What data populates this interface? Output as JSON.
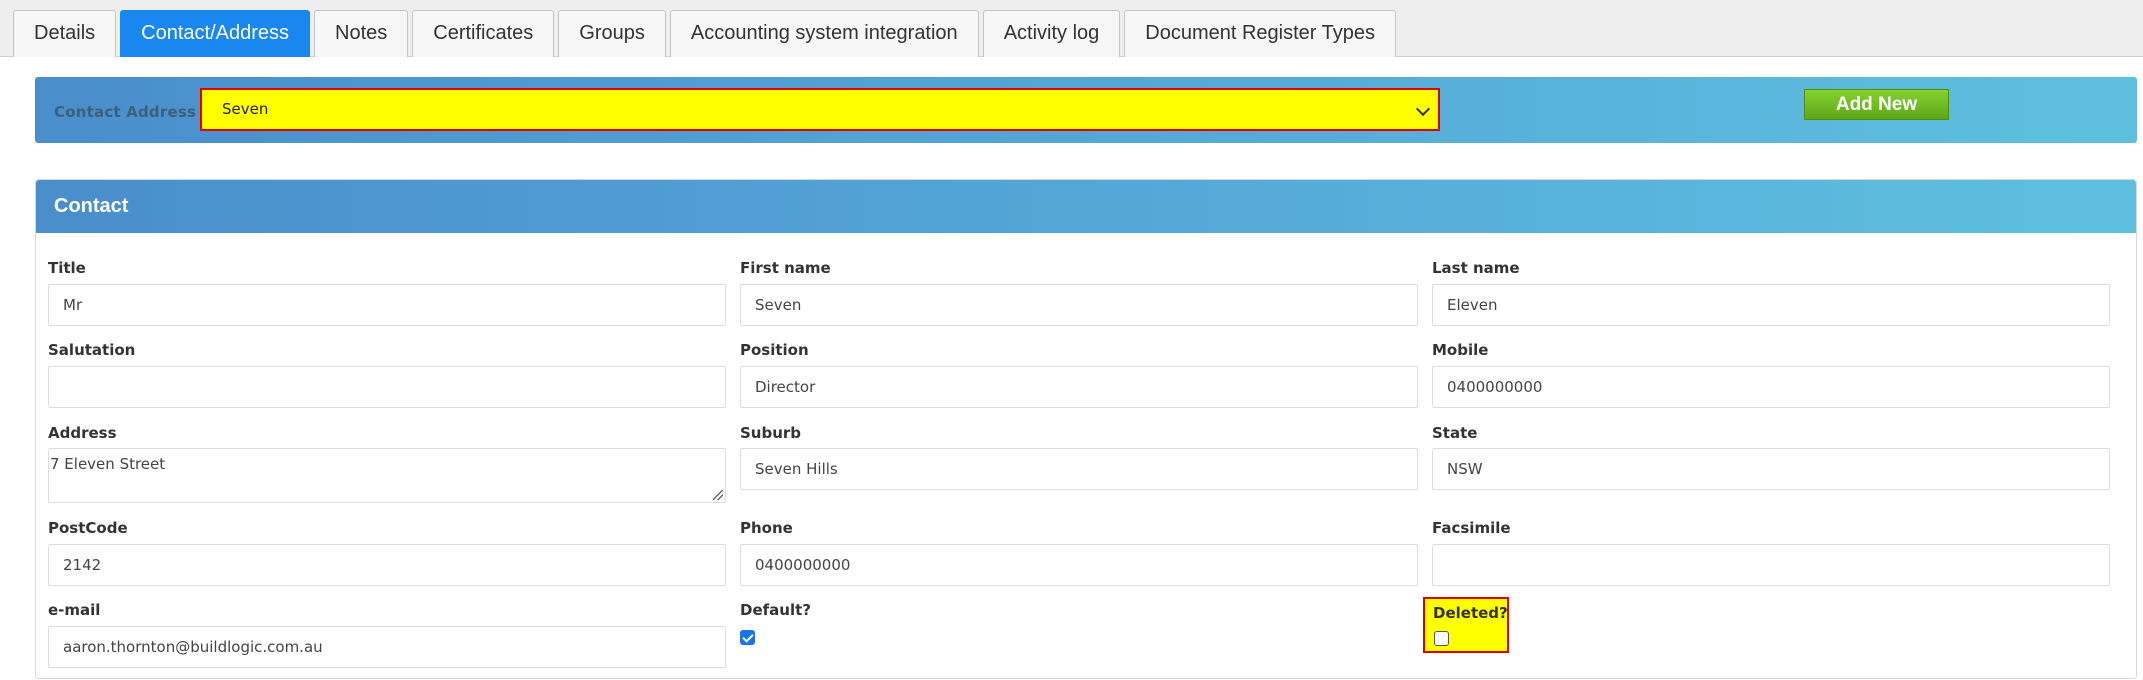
{
  "tabs": [
    {
      "label": "Details",
      "active": false
    },
    {
      "label": "Contact/Address",
      "active": true
    },
    {
      "label": "Notes",
      "active": false
    },
    {
      "label": "Certificates",
      "active": false
    },
    {
      "label": "Groups",
      "active": false
    },
    {
      "label": "Accounting system integration",
      "active": false
    },
    {
      "label": "Activity log",
      "active": false
    },
    {
      "label": "Document Register Types",
      "active": false
    }
  ],
  "selector": {
    "label": "Contact Address for",
    "selected_value": "Seven",
    "add_new_label": "Add New"
  },
  "contact": {
    "title": "Contact",
    "fields": {
      "title": {
        "label": "Title",
        "value": "Mr"
      },
      "first_name": {
        "label": "First name",
        "value": "Seven"
      },
      "last_name": {
        "label": "Last name",
        "value": "Eleven"
      },
      "salutation": {
        "label": "Salutation",
        "value": ""
      },
      "position": {
        "label": "Position",
        "value": "Director"
      },
      "mobile": {
        "label": "Mobile",
        "value": "0400000000"
      },
      "address": {
        "label": "Address",
        "value": "7 Eleven Street"
      },
      "suburb": {
        "label": "Suburb",
        "value": "Seven Hills"
      },
      "state": {
        "label": "State",
        "value": "NSW"
      },
      "postcode": {
        "label": "PostCode",
        "value": "2142"
      },
      "phone": {
        "label": "Phone",
        "value": "0400000000"
      },
      "facsimile": {
        "label": "Facsimile",
        "value": ""
      },
      "email": {
        "label": "e-mail",
        "value": "aaron.thornton@buildlogic.com.au"
      },
      "default": {
        "label": "Default?",
        "checked": true
      },
      "deleted": {
        "label": "Deleted?",
        "checked": false
      }
    }
  },
  "colors": {
    "tab_active": "#1a86f0",
    "header_gradient_start": "#4a8ecc",
    "header_gradient_end": "#5ec0de",
    "highlight_yellow": "#ffff00",
    "highlight_border": "#e00000",
    "add_button_green": "#6cb821"
  }
}
